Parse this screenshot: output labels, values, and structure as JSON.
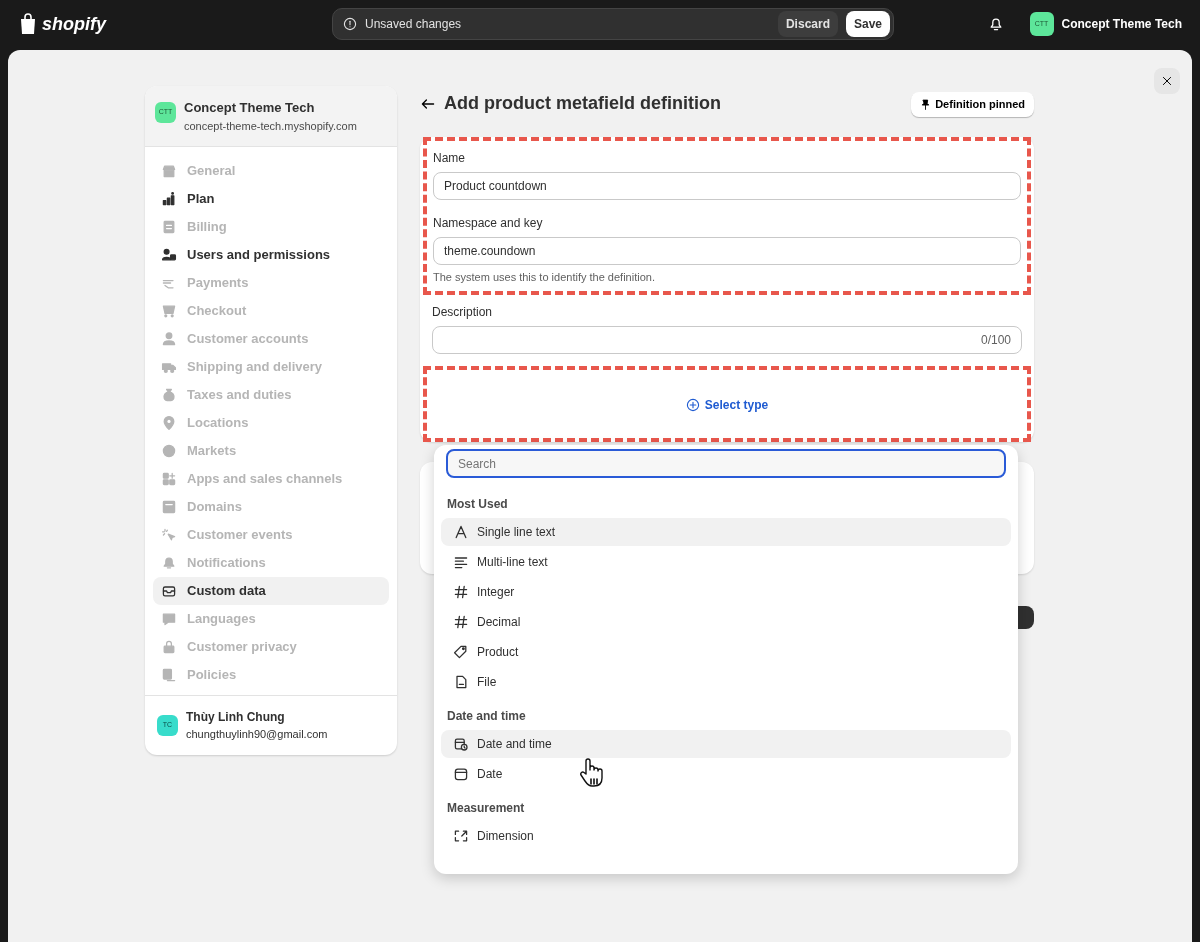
{
  "topbar": {
    "logo": "shopify",
    "unsaved": {
      "message": "Unsaved changes",
      "buttons": [
        {
          "label": "Discard",
          "kind": "secondary"
        },
        {
          "label": "Save",
          "kind": "primary"
        }
      ]
    },
    "store": {
      "initials": "CTT",
      "name": "Concept Theme Tech"
    }
  },
  "sidebar": {
    "store": {
      "initials": "CTT",
      "name": "Concept Theme Tech",
      "domain": "concept-theme-tech.myshopify.com"
    },
    "items": [
      {
        "label": "General",
        "kind": "general",
        "disabled": true,
        "selected": false
      },
      {
        "label": "Plan",
        "kind": "plan",
        "disabled": false,
        "selected": false
      },
      {
        "label": "Billing",
        "kind": "billing",
        "disabled": true,
        "selected": false
      },
      {
        "label": "Users and permissions",
        "kind": "users",
        "disabled": false,
        "selected": false
      },
      {
        "label": "Payments",
        "kind": "payments",
        "disabled": true,
        "selected": false
      },
      {
        "label": "Checkout",
        "kind": "checkout",
        "disabled": true,
        "selected": false
      },
      {
        "label": "Customer accounts",
        "kind": "accounts",
        "disabled": true,
        "selected": false
      },
      {
        "label": "Shipping and delivery",
        "kind": "shipping",
        "disabled": true,
        "selected": false
      },
      {
        "label": "Taxes and duties",
        "kind": "taxes",
        "disabled": true,
        "selected": false
      },
      {
        "label": "Locations",
        "kind": "locations",
        "disabled": true,
        "selected": false
      },
      {
        "label": "Markets",
        "kind": "markets",
        "disabled": true,
        "selected": false
      },
      {
        "label": "Apps and sales channels",
        "kind": "apps",
        "disabled": true,
        "selected": false
      },
      {
        "label": "Domains",
        "kind": "domains",
        "disabled": true,
        "selected": false
      },
      {
        "label": "Customer events",
        "kind": "events",
        "disabled": true,
        "selected": false
      },
      {
        "label": "Notifications",
        "kind": "notifications",
        "disabled": true,
        "selected": false
      },
      {
        "label": "Custom data",
        "kind": "custom",
        "disabled": false,
        "selected": true
      },
      {
        "label": "Languages",
        "kind": "languages",
        "disabled": true,
        "selected": false
      },
      {
        "label": "Customer privacy",
        "kind": "privacy",
        "disabled": true,
        "selected": false
      },
      {
        "label": "Policies",
        "kind": "policies",
        "disabled": true,
        "selected": false
      }
    ],
    "user": {
      "initials": "TC",
      "name": "Thùy Linh Chung",
      "email": "chungthuylinh90@gmail.com"
    }
  },
  "page": {
    "title": "Add product metafield definition",
    "pinned_button": "Definition pinned"
  },
  "form": {
    "sections": [
      {
        "annotated": true,
        "fields": [
          {
            "label": "Name",
            "value": "Product countdown"
          },
          {
            "label": "Namespace and key",
            "value": "theme.coundown",
            "help": "The system uses this to identify the definition."
          }
        ]
      },
      {
        "annotated": false,
        "fields": [
          {
            "label": "Description",
            "counter": "0/100"
          }
        ]
      },
      {
        "annotated": true,
        "action": "Select type"
      }
    ]
  },
  "type_menu": {
    "search_placeholder": "Search",
    "groups": [
      {
        "title": "Most Used",
        "items": [
          {
            "label": "Single line text",
            "kind": "text",
            "highlighted": true
          },
          {
            "label": "Multi-line text",
            "kind": "multiline",
            "highlighted": false
          },
          {
            "label": "Integer",
            "kind": "integer",
            "highlighted": false
          },
          {
            "label": "Decimal",
            "kind": "decimal",
            "highlighted": false
          },
          {
            "label": "Product",
            "kind": "product",
            "highlighted": false
          },
          {
            "label": "File",
            "kind": "file",
            "highlighted": false
          }
        ]
      },
      {
        "title": "Date and time",
        "items": [
          {
            "label": "Date and time",
            "kind": "datetime",
            "highlighted": true
          },
          {
            "label": "Date",
            "kind": "date",
            "highlighted": false
          }
        ]
      },
      {
        "title": "Measurement",
        "items": [
          {
            "label": "Dimension",
            "kind": "dimension",
            "highlighted": false
          }
        ]
      }
    ]
  }
}
